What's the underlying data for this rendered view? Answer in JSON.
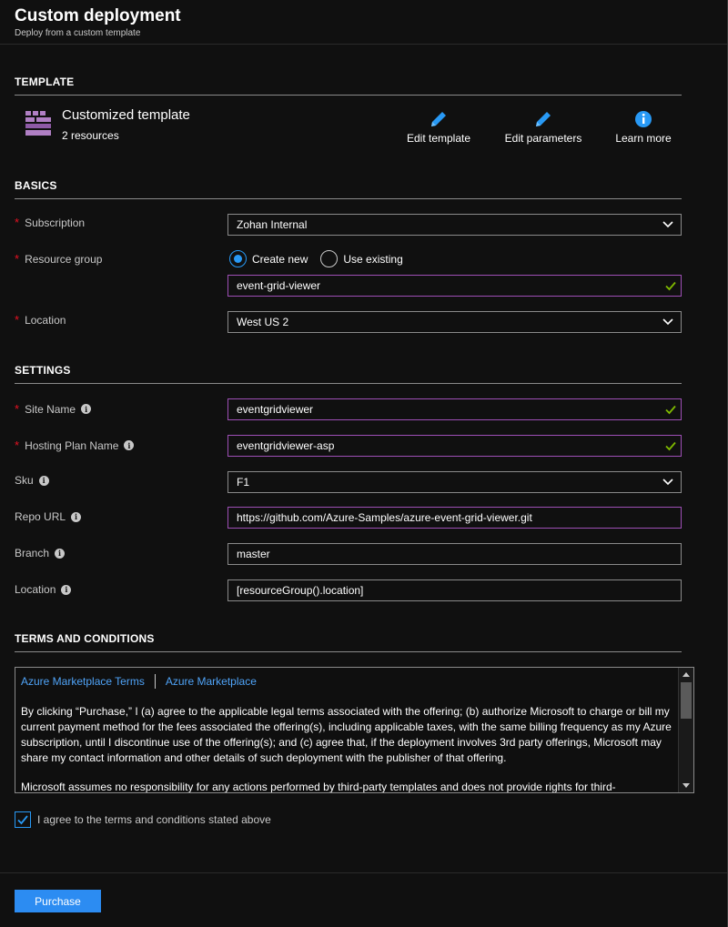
{
  "header": {
    "title": "Custom deployment",
    "subtitle": "Deploy from a custom template"
  },
  "template_section": {
    "title": "TEMPLATE",
    "name": "Customized template",
    "resources": "2 resources",
    "actions": [
      {
        "label": "Edit template",
        "icon": "pencil-icon"
      },
      {
        "label": "Edit parameters",
        "icon": "pencil-icon"
      },
      {
        "label": "Learn more",
        "icon": "info-icon"
      }
    ]
  },
  "basics": {
    "title": "BASICS",
    "subscription": {
      "label": "Subscription",
      "value": "Zohan Internal"
    },
    "resource_group": {
      "label": "Resource group",
      "options": [
        "Create new",
        "Use existing"
      ],
      "selected": "Create new",
      "value": "event-grid-viewer"
    },
    "location": {
      "label": "Location",
      "value": "West US 2"
    }
  },
  "settings": {
    "title": "SETTINGS",
    "site_name": {
      "label": "Site Name",
      "value": "eventgridviewer"
    },
    "hosting_plan_name": {
      "label": "Hosting Plan Name",
      "value": "eventgridviewer-asp"
    },
    "sku": {
      "label": "Sku",
      "value": "F1"
    },
    "repo_url": {
      "label": "Repo URL",
      "value": "https://github.com/Azure-Samples/azure-event-grid-viewer.git"
    },
    "branch": {
      "label": "Branch",
      "value": "master"
    },
    "location": {
      "label": "Location",
      "value": "[resourceGroup().location]"
    }
  },
  "terms": {
    "title": "TERMS AND CONDITIONS",
    "link1": "Azure Marketplace Terms",
    "link2": "Azure Marketplace",
    "paragraph1": "By clicking “Purchase,” I (a) agree to the applicable legal terms associated with the offering; (b) authorize Microsoft to charge or bill my current payment method for the fees associated the offering(s), including applicable taxes, with the same billing frequency as my Azure subscription, until I discontinue use of the offering(s); and (c) agree that, if the deployment involves 3rd party offerings, Microsoft may share my contact information and other details of such deployment with the publisher of that offering.",
    "paragraph2": "Microsoft assumes no responsibility for any actions performed by third-party templates and does not provide rights for third-",
    "agree_label": "I agree to the terms and conditions stated above",
    "agree_checked": true
  },
  "footer": {
    "purchase_label": "Purchase"
  },
  "colors": {
    "accent": "#2899f5",
    "valid_border": "#9e4fb6",
    "valid_check": "#7fba00",
    "required": "#e81123",
    "template_icon": "#b07fc4"
  }
}
